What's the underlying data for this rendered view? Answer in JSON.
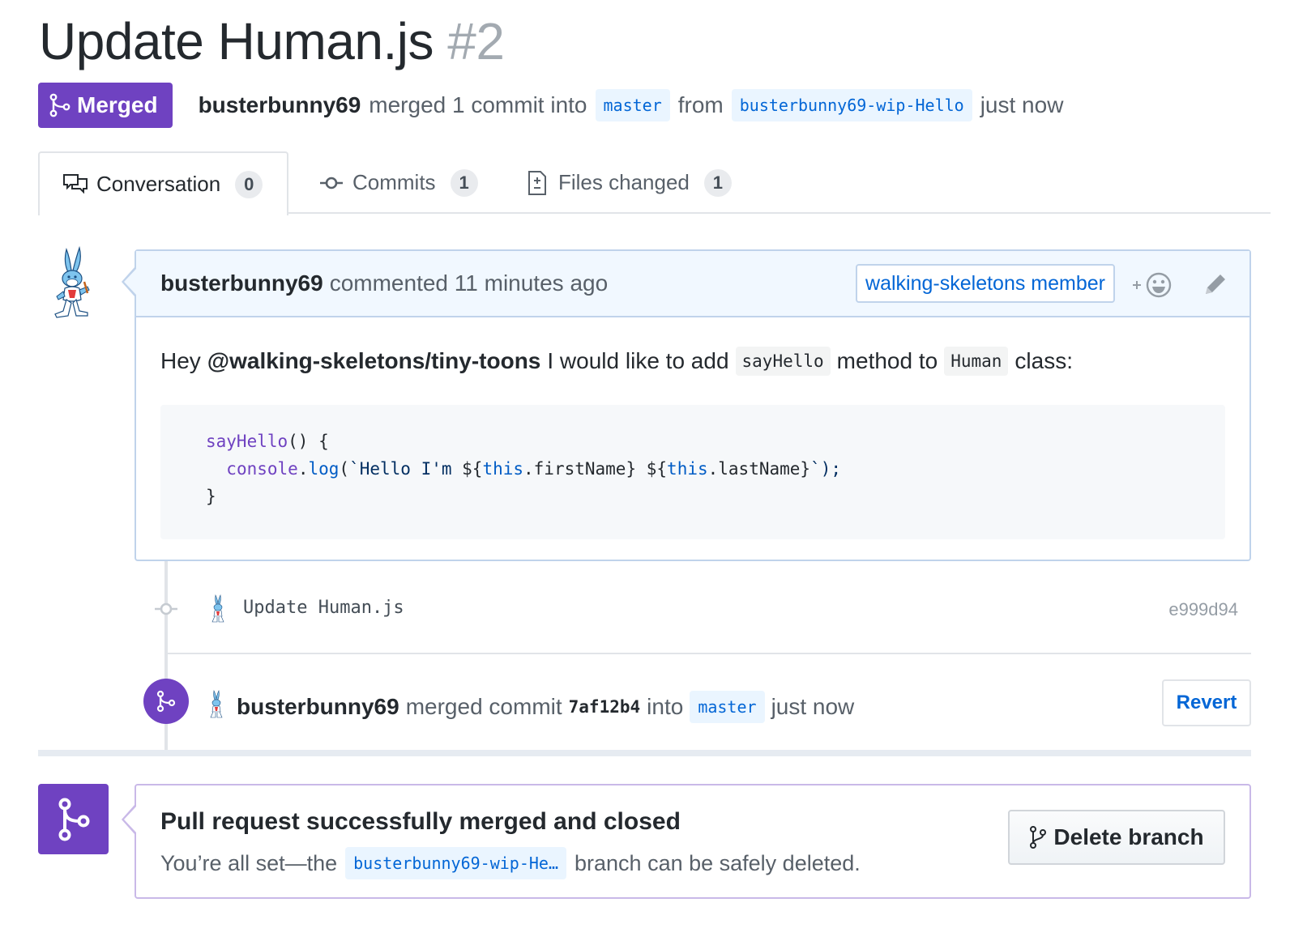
{
  "header": {
    "title": "Update Human.js",
    "number": "#2"
  },
  "status": {
    "badge_label": "Merged",
    "author": "busterbunny69",
    "action": "merged 1 commit into",
    "base_branch": "master",
    "from_word": "from",
    "head_branch": "busterbunny69-wip-Hello",
    "time": "just now"
  },
  "tabs": [
    {
      "label": "Conversation",
      "count": "0",
      "icon": "comment-discussion-icon"
    },
    {
      "label": "Commits",
      "count": "1",
      "icon": "git-commit-icon"
    },
    {
      "label": "Files changed",
      "count": "1",
      "icon": "diff-icon"
    }
  ],
  "comment": {
    "author": "busterbunny69",
    "meta": "commented 11 minutes ago",
    "member_label": "walking-skeletons member",
    "body_prefix": "Hey",
    "mention": "@walking-skeletons/tiny-toons",
    "body_mid1": "I would like to add",
    "code_method": "sayHello",
    "body_mid2": "method to",
    "code_class": "Human",
    "body_suffix": "class:",
    "code_lines": {
      "l1_fn": "sayHello",
      "l1_rest": "() {",
      "l2_indent": "  ",
      "l2_obj": "console",
      "l2_dot": ".",
      "l2_call": "log",
      "l2_open": "(",
      "l2_str1": "`Hello I'm ",
      "l2_interp1_open": "${",
      "l2_this1": "this",
      "l2_prop1": ".firstName}",
      "l2_space": " ",
      "l2_interp2_open": "${",
      "l2_this2": "this",
      "l2_prop2": ".lastName}",
      "l2_close": "`);",
      "l3": "}"
    }
  },
  "commit": {
    "message": "Update Human.js",
    "sha": "e999d94"
  },
  "merge_event": {
    "author": "busterbunny69",
    "action": "merged commit",
    "sha": "7af12b4",
    "into_word": "into",
    "branch": "master",
    "time": "just now",
    "revert_label": "Revert"
  },
  "merged_box": {
    "title": "Pull request successfully merged and closed",
    "sub_prefix": "You’re all set—the",
    "branch": "busterbunny69-wip-He…",
    "sub_suffix": "branch can be safely deleted.",
    "delete_label": "Delete branch"
  },
  "colors": {
    "merged_purple": "#6f42c1",
    "link_blue": "#0366d6",
    "branch_bg": "#eaf5ff",
    "comment_head_bg": "#f1f8ff"
  }
}
